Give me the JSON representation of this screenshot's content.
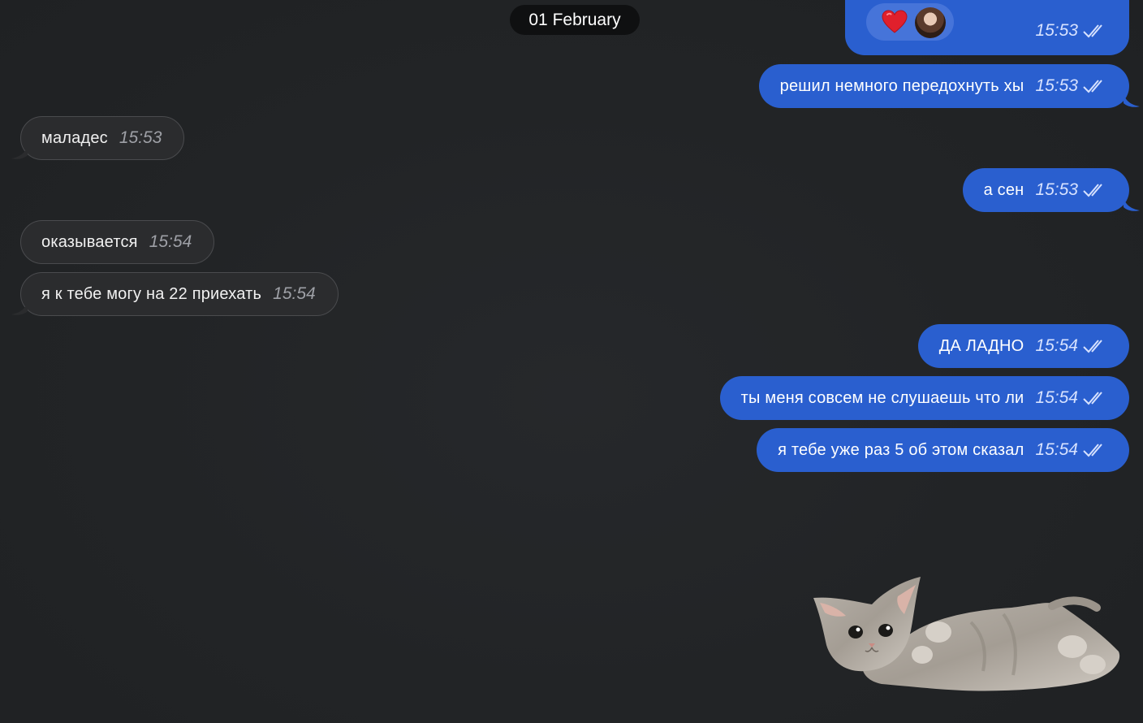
{
  "date_separator": "01 February",
  "reaction_message": {
    "reaction_emoji_name": "heart",
    "time": "15:53",
    "status_icon": "double-check-icon"
  },
  "messages": [
    {
      "direction": "out",
      "text": "решил немного передохнуть хы",
      "time": "15:53"
    },
    {
      "direction": "in",
      "text": "маладес",
      "time": "15:53"
    },
    {
      "direction": "out",
      "text": "а сен",
      "time": "15:53"
    },
    {
      "direction": "in",
      "text": "оказывается",
      "time": "15:54"
    },
    {
      "direction": "in",
      "text": "я к тебе могу на 22 приехать",
      "time": "15:54"
    },
    {
      "direction": "out",
      "text": "ДА ЛАДНО",
      "time": "15:54"
    },
    {
      "direction": "out",
      "text": "ты меня совсем не слушаешь что ли",
      "time": "15:54"
    },
    {
      "direction": "out",
      "text": "я тебе уже раз 5 об этом сказал",
      "time": "15:54"
    }
  ],
  "sticker": {
    "icon": "kitten-sticker-icon"
  },
  "colors": {
    "background": "#222426",
    "outgoing_bubble": "#2a5fcf",
    "incoming_bubble": "#2b2c2e",
    "date_pill": "#0f1011"
  }
}
